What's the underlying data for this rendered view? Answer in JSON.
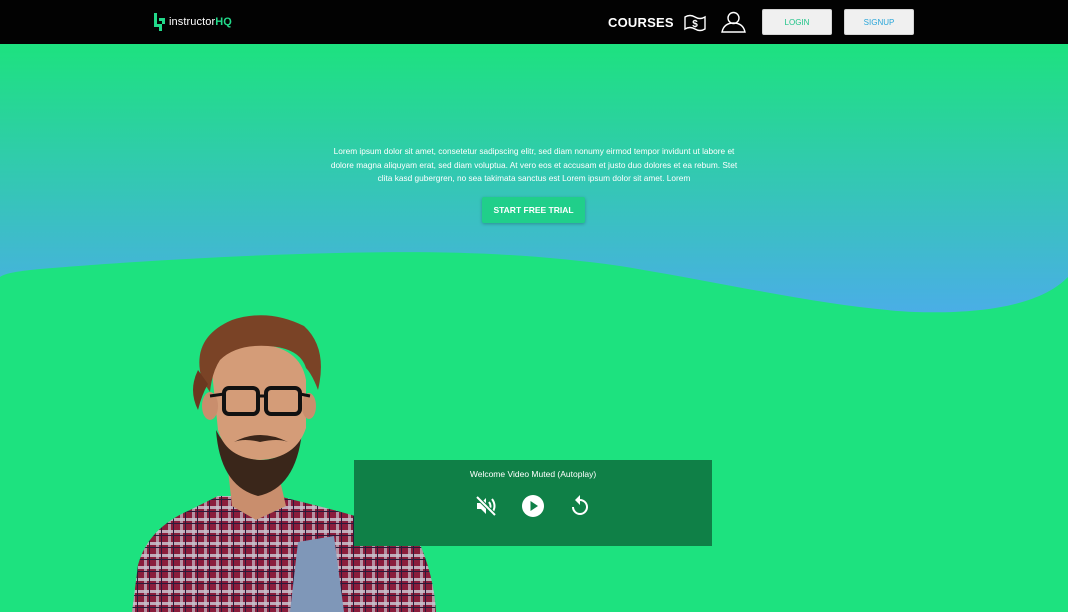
{
  "header": {
    "logo": {
      "prefix": "instructor",
      "suffix": "HQ",
      "icon": "instructorhq-logo-icon"
    },
    "nav": {
      "courses_label": "COURSES",
      "pricing_icon": "money-bill-icon",
      "account_icon": "user-icon"
    },
    "login_label": "LOGIN",
    "signup_label": "SIGNUP"
  },
  "hero": {
    "description": "Lorem ipsum dolor sit amet, consetetur sadipscing elitr, sed diam nonumy eirmod tempor invidunt ut labore et dolore magna aliquyam erat, sed diam voluptua. At vero eos et accusam et justo duo dolores et ea rebum. Stet clita kasd gubergren, no sea takimata sanctus est Lorem ipsum dolor sit amet. Lorem",
    "cta_label": "START FREE TRIAL",
    "gradient": {
      "top": "#1de27f",
      "bottom": "#4aaee6"
    }
  },
  "video": {
    "title": "Welcome Video Muted (Autoplay)",
    "controls": [
      "volume-muted-icon",
      "play-icon",
      "replay-icon"
    ]
  },
  "colors": {
    "page_bg": "#1de27f",
    "topbar": "#020202",
    "video_panel": "#0f8047"
  }
}
